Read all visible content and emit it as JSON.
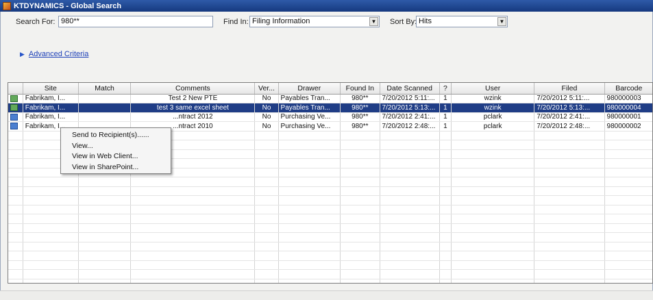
{
  "window": {
    "title": "KTDYNAMICS - Global Search"
  },
  "search": {
    "search_for_label": "Search For:",
    "search_for_value": "980**",
    "find_in_label": "Find In:",
    "find_in_value": "Filing Information",
    "sort_by_label": "Sort By:",
    "sort_by_value": "Hits",
    "advanced_label": "Advanced Criteria"
  },
  "table": {
    "columns": [
      "",
      "Site",
      "Match",
      "Comments",
      "Ver...",
      "Drawer",
      "Found In",
      "Date Scanned",
      "?",
      "User",
      "Filed",
      "Barcode"
    ],
    "rows": [
      {
        "icon": "excel-file-icon",
        "site": "Fabrikam, I...",
        "match": "",
        "comments": "Test 2 New PTE",
        "ver": "No",
        "drawer": "Payables Tran...",
        "found_in": "980**",
        "date_scanned": "7/20/2012 5:11:...",
        "q": "1",
        "user": "wzink",
        "filed": "7/20/2012 5:11:...",
        "barcode": "980000003",
        "selected": false
      },
      {
        "icon": "excel-file-icon",
        "site": "Fabrikam, I...",
        "match": "",
        "comments": "test 3 same excel sheet",
        "ver": "No",
        "drawer": "Payables Tran...",
        "found_in": "980**",
        "date_scanned": "7/20/2012 5:13:...",
        "q": "1",
        "user": "wzink",
        "filed": "7/20/2012 5:13:...",
        "barcode": "980000004",
        "selected": true
      },
      {
        "icon": "word-file-icon",
        "site": "Fabrikam, I...",
        "match": "",
        "comments": "...ntract 2012",
        "ver": "No",
        "drawer": "Purchasing Ve...",
        "found_in": "980**",
        "date_scanned": "7/20/2012 2:41:...",
        "q": "1",
        "user": "pclark",
        "filed": "7/20/2012 2:41:...",
        "barcode": "980000001",
        "selected": false
      },
      {
        "icon": "word-file-icon",
        "site": "Fabrikam, I...",
        "match": "",
        "comments": "...ntract 2010",
        "ver": "No",
        "drawer": "Purchasing Ve...",
        "found_in": "980**",
        "date_scanned": "7/20/2012 2:48:...",
        "q": "1",
        "user": "pclark",
        "filed": "7/20/2012 2:48:...",
        "barcode": "980000002",
        "selected": false
      }
    ]
  },
  "context_menu": {
    "items": [
      "Send to Recipient(s)......",
      "View...",
      "View in Web Client...",
      "View in SharePoint..."
    ]
  }
}
